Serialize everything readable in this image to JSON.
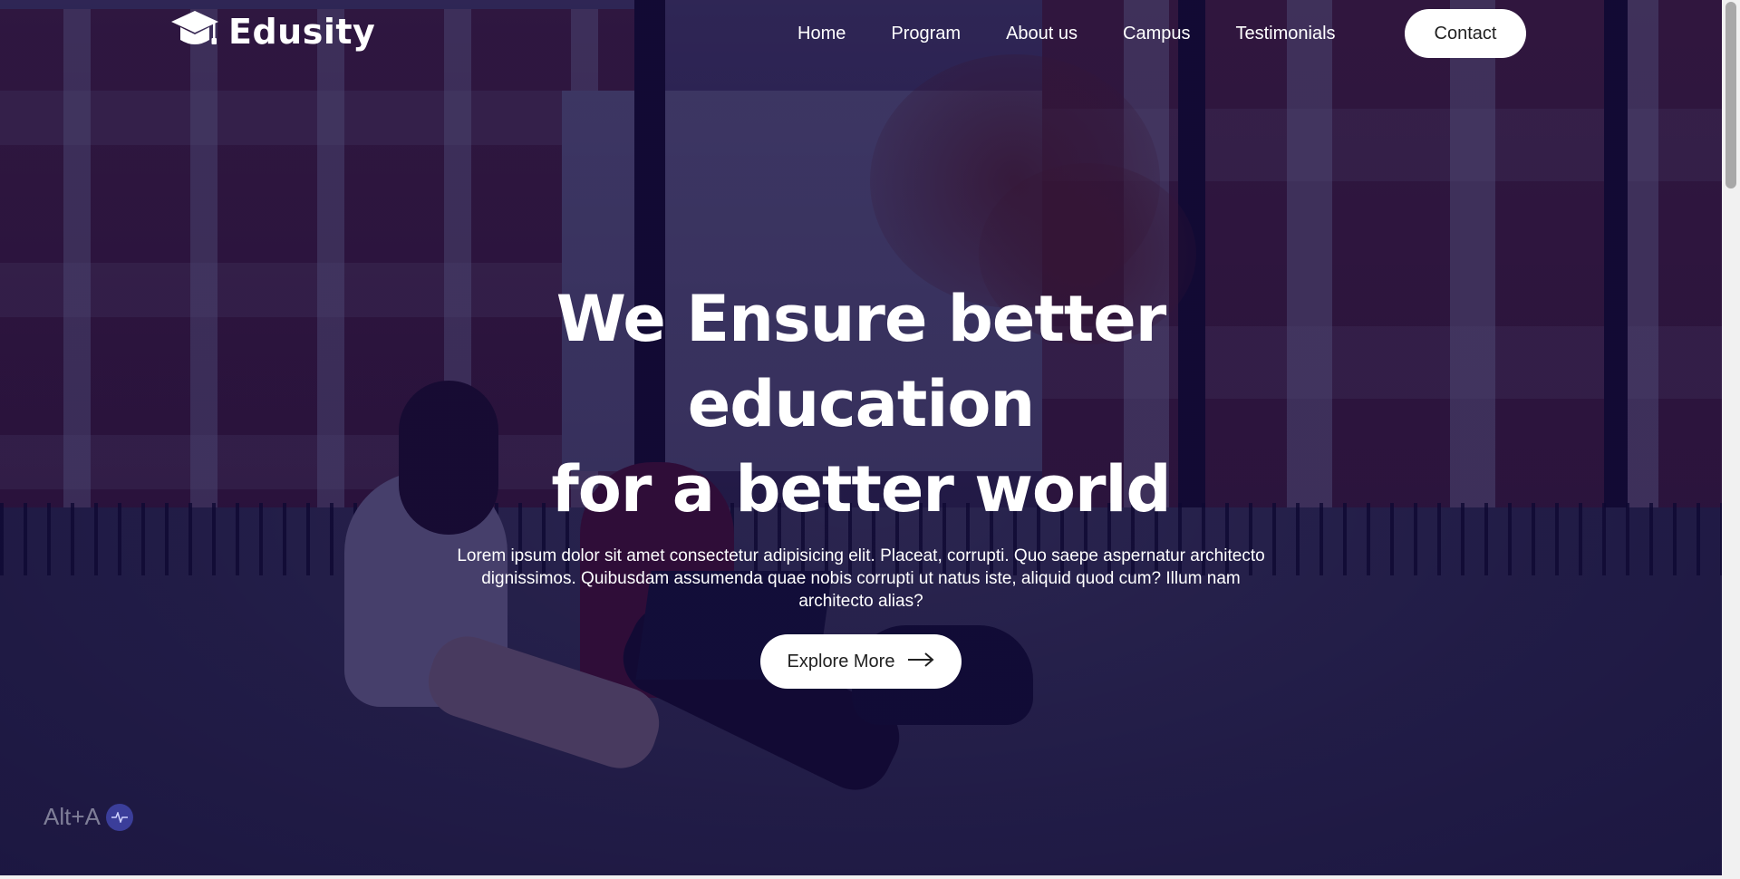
{
  "brand": {
    "name": "Edusity",
    "logo_icon": "graduation-cap-icon"
  },
  "nav": {
    "items": [
      "Home",
      "Program",
      "About us",
      "Campus",
      "Testimonials"
    ],
    "contact_label": "Contact"
  },
  "hero": {
    "title_line1": "We Ensure better education",
    "title_line2": "for a better world",
    "description": "Lorem ipsum dolor sit amet consectetur adipisicing elit. Placeat, corrupti. Quo saepe aspernatur architecto dignissimos. Quibusdam assumenda quae nobis corrupti ut natus iste, aliquid quod cum? Illum nam architecto alias?",
    "cta_label": "Explore More",
    "cta_icon": "arrow-right-icon"
  },
  "overlay_badge": {
    "label": "Alt+A",
    "icon": "pulse-icon"
  },
  "colors": {
    "overlay": "#08003A",
    "text": "#FFFFFF",
    "button_bg": "#FFFFFF",
    "button_text": "#212121",
    "badge_icon_bg": "#3B3E9A"
  }
}
